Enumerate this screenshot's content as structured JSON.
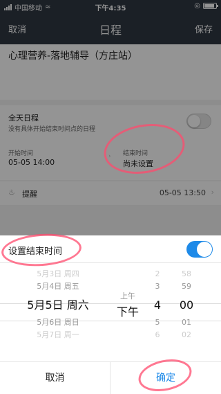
{
  "status_bar": {
    "carrier": "中国移动",
    "time": "下午4:35"
  },
  "nav": {
    "cancel_label": "取消",
    "title": "日程",
    "save_label": "保存"
  },
  "event": {
    "title": "心理营养-落地辅导（方庄站）",
    "all_day_label": "全天日程",
    "all_day_desc": "没有具体开始结束时间点的日程",
    "start_label": "开始时间",
    "start_value": "05-05 14:00",
    "end_label": "结束时间",
    "end_value": "尚未设置",
    "reminder_label": "提醒",
    "reminder_value": "05-05 13:50"
  },
  "sheet": {
    "toggle_label": "设置结束时间",
    "toggle_on": true,
    "date_column": [
      "5月3日 周四",
      "5月4日 周五",
      "5月5日 周六",
      "5月6日 周日",
      "5月7日 周一"
    ],
    "ampm_column": [
      "上午",
      "下午"
    ],
    "hour_column": [
      "2",
      "3",
      "4",
      "5",
      "6"
    ],
    "minute_column": [
      "58",
      "59",
      "00",
      "01",
      "02"
    ],
    "cancel_label": "取消",
    "confirm_label": "确定"
  },
  "colors": {
    "accent": "#1e8ae8",
    "nav_bg": "#2f3743",
    "annotation": "#ff4b6e"
  }
}
